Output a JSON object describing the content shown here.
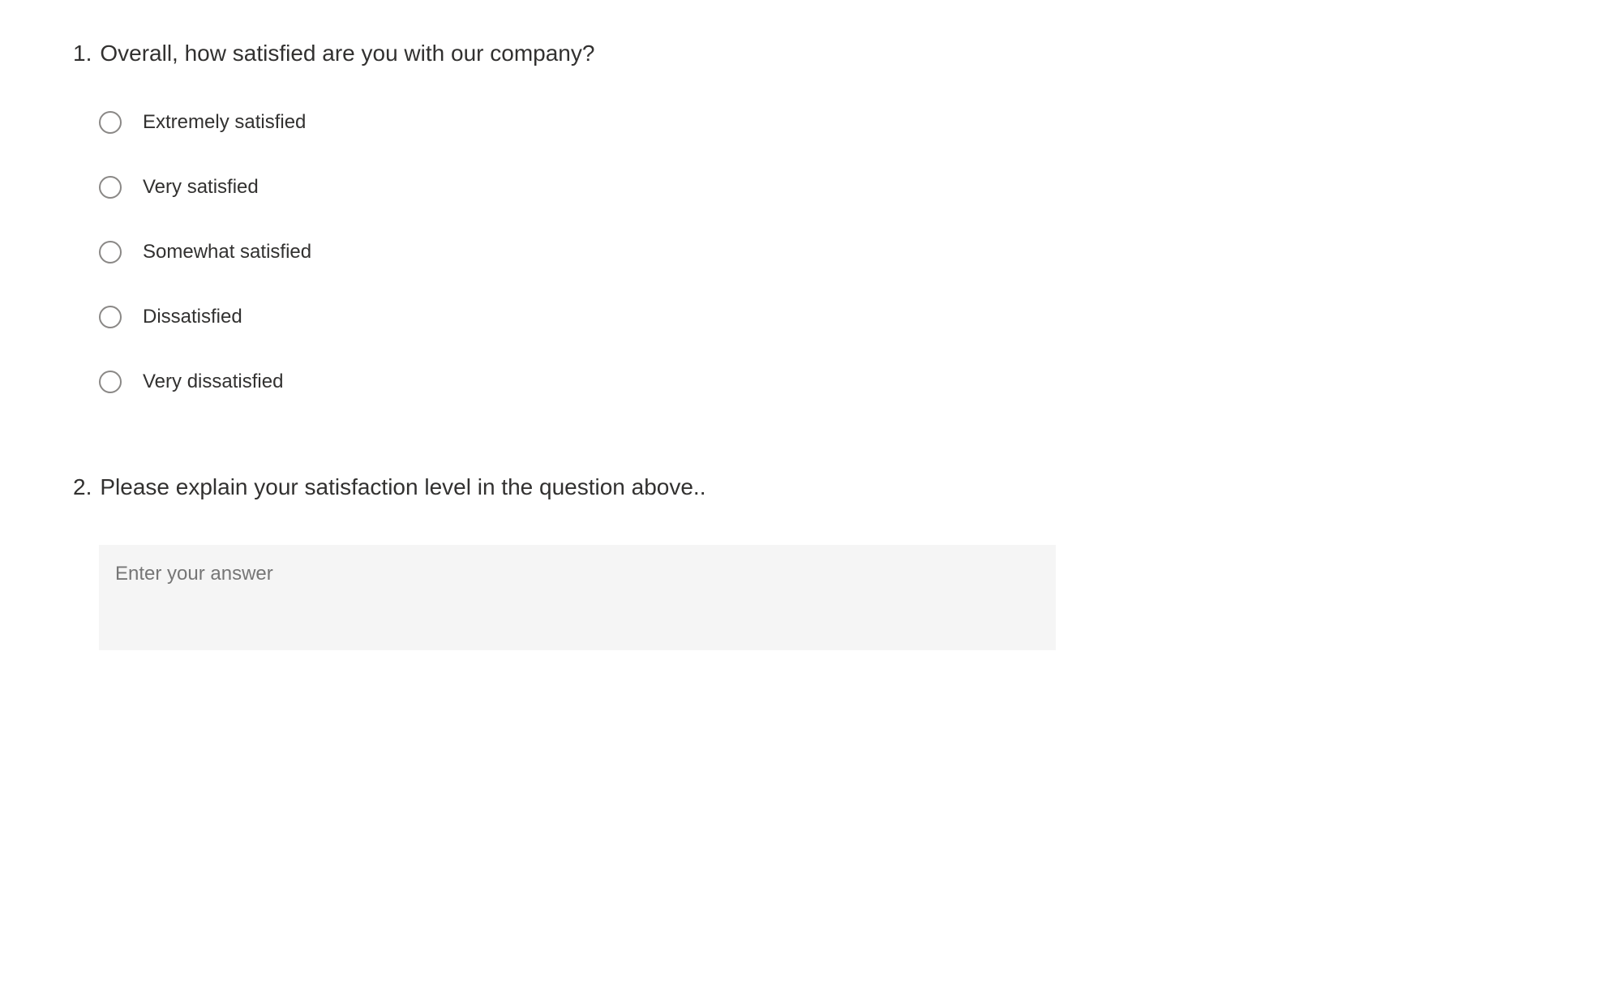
{
  "questions": [
    {
      "number": "1.",
      "text": "Overall, how satisfied are you with our company?",
      "type": "radio",
      "options": [
        "Extremely satisfied",
        "Very satisfied",
        "Somewhat satisfied",
        "Dissatisfied",
        "Very dissatisfied"
      ]
    },
    {
      "number": "2.",
      "text": "Please explain your satisfaction level in the question above..",
      "type": "text",
      "placeholder": "Enter your answer"
    }
  ]
}
